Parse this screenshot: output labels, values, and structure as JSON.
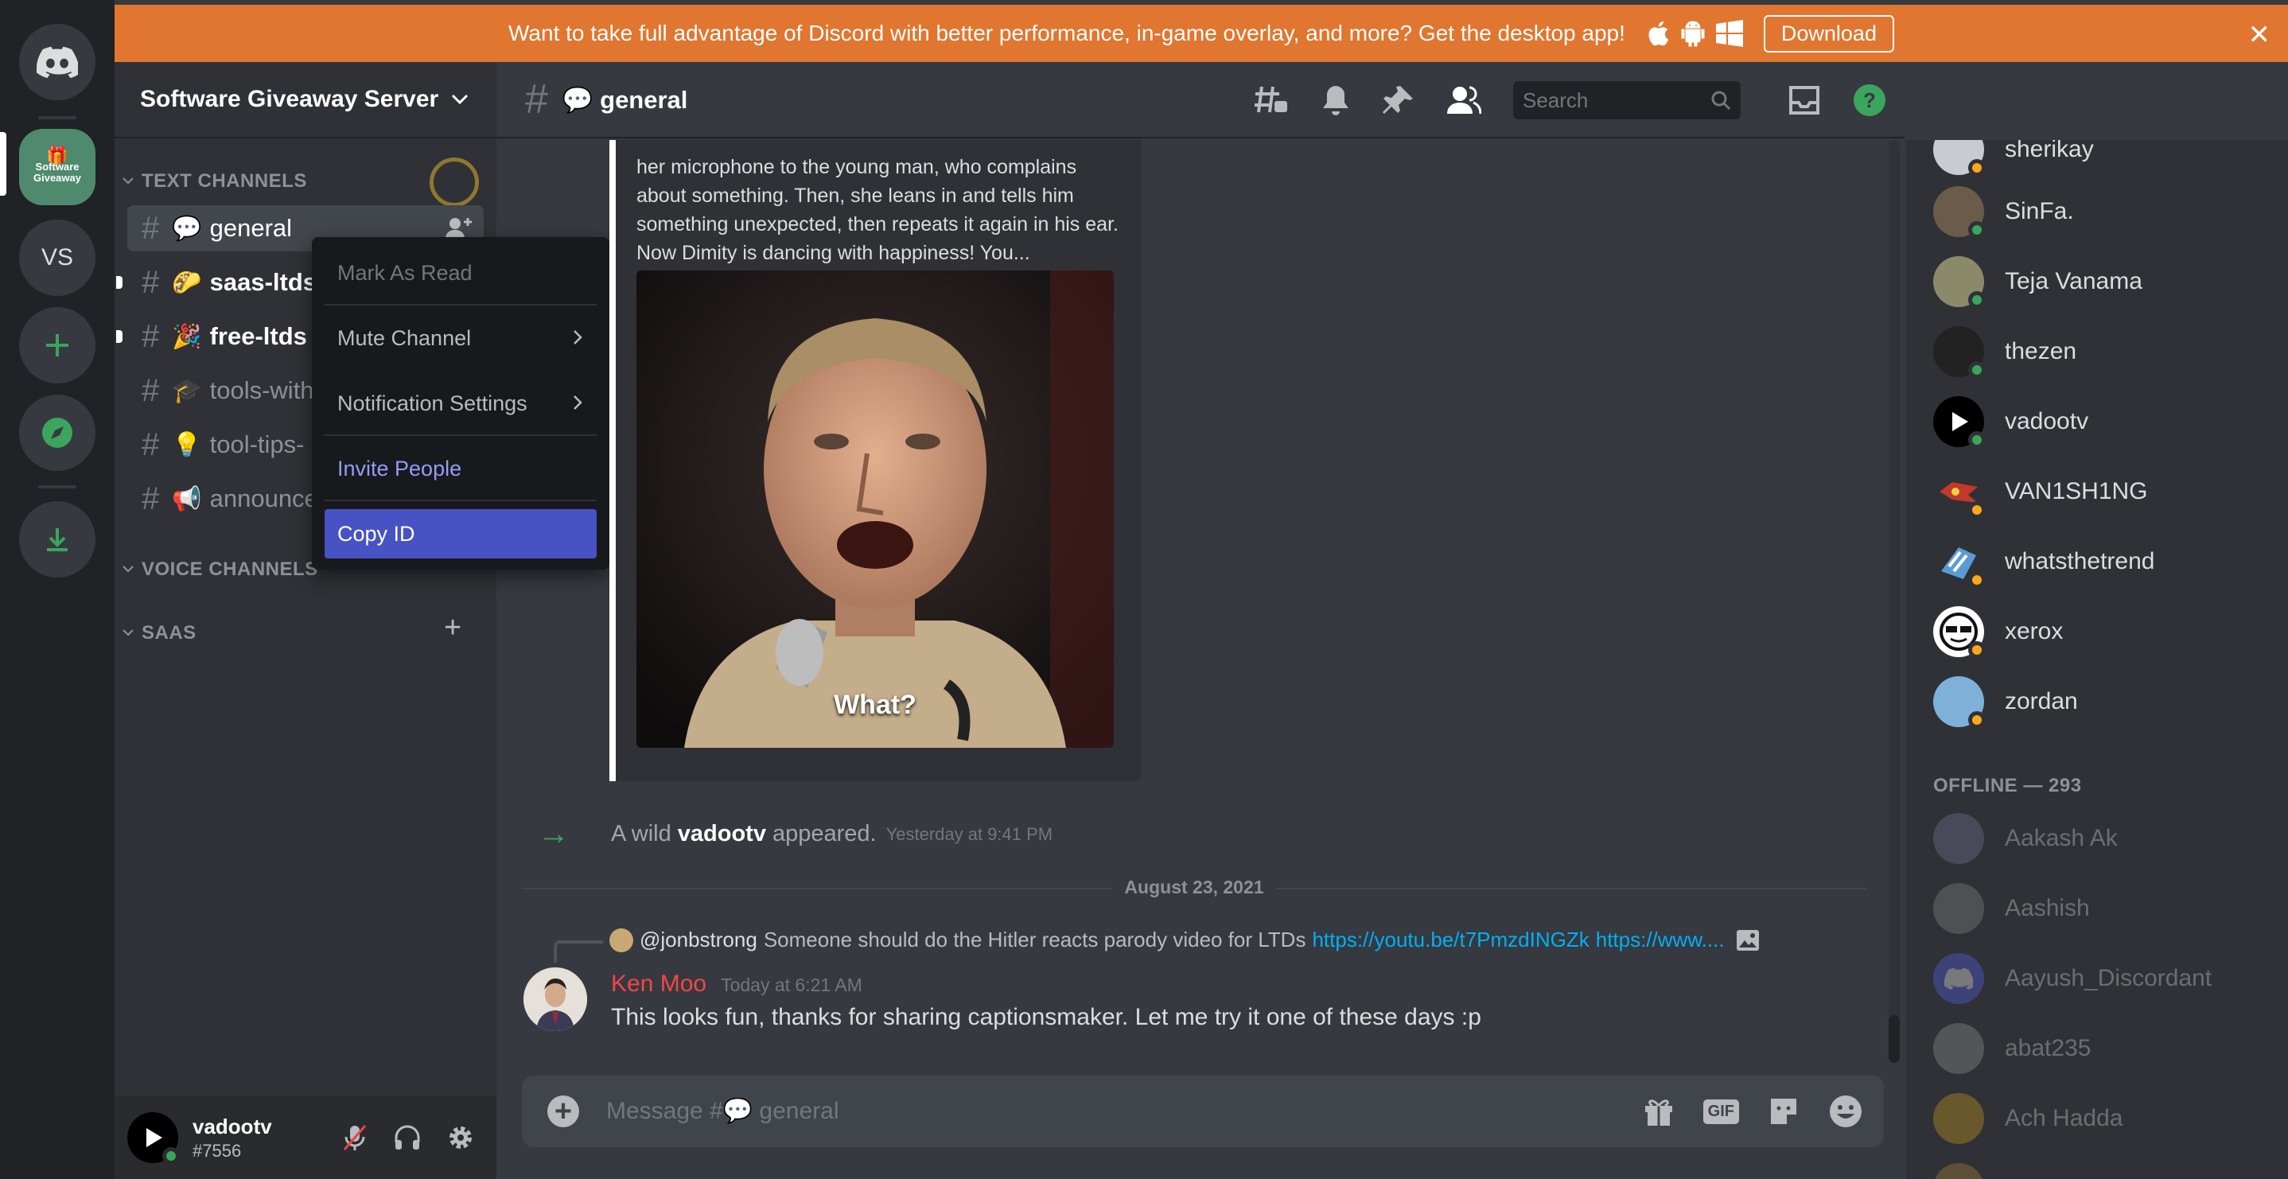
{
  "banner": {
    "text": "Want to take full advantage of Discord with better performance, in-game overlay, and more? Get the desktop app!",
    "download_label": "Download",
    "close_glyph": "✕"
  },
  "rail": {
    "home_icon": "discord-logo-icon",
    "active_server_label": "Software Giveaway",
    "server2_label": "VS",
    "add_icon": "plus-icon",
    "explore_icon": "compass-icon",
    "download_icon": "download-icon"
  },
  "server": {
    "name": "Software Giveaway Server"
  },
  "categories": {
    "text": "TEXT CHANNELS",
    "voice": "VOICE CHANNELS",
    "saas": "SAAS"
  },
  "channels": [
    {
      "emoji": "💬",
      "name": "general"
    },
    {
      "emoji": "🌮",
      "name": "saas-ltds"
    },
    {
      "emoji": "🎉",
      "name": "free-ltds"
    },
    {
      "emoji": "🎓",
      "name": "tools-with"
    },
    {
      "emoji": "💡",
      "name": "tool-tips-"
    },
    {
      "emoji": "📢",
      "name": "announce"
    }
  ],
  "context_menu": {
    "mark_read": "Mark As Read",
    "mute": "Mute Channel",
    "notifications": "Notification Settings",
    "invite": "Invite People",
    "copy_id": "Copy ID"
  },
  "user": {
    "name": "vadootv",
    "tag": "#7556"
  },
  "chat": {
    "channel_title": "💬 general",
    "search_placeholder": "Search",
    "embed_text": "her microphone to the young man, who complains about something. Then, she leans in and tells him something unexpected, then repeats it again in his ear. Now Dimity is dancing with happiness! You...",
    "embed_caption": "What?",
    "system_msg": {
      "prefix": "A wild",
      "user": "vadootv",
      "suffix": "appeared.",
      "time": "Yesterday at 9:41 PM"
    },
    "date_divider": "August 23, 2021",
    "reply": {
      "mention": "@jonbstrong",
      "text": "Someone should do the Hitler reacts parody video for LTDs",
      "link1": "https://youtu.be/t7PmzdINGZk",
      "link2": "https://www...."
    },
    "message": {
      "author": "Ken Moo",
      "timestamp": "Today at 6:21 AM",
      "body": "This looks fun, thanks for sharing captionsmaker. Let me try it one of these days :p"
    },
    "composer_placeholder": "Message #💬 general"
  },
  "members": {
    "online": [
      {
        "name": "sherikay",
        "status": "idle",
        "color": "#c8ccd2"
      },
      {
        "name": "SinFa.",
        "status": "online",
        "color": "#6b5b4b"
      },
      {
        "name": "Teja Vanama",
        "status": "online",
        "color": "#8a8a6a"
      },
      {
        "name": "thezen",
        "status": "online",
        "color": "#222222"
      },
      {
        "name": "vadootv",
        "status": "online",
        "color": "#000000"
      },
      {
        "name": "VAN1SH1NG",
        "status": "idle",
        "color": "#c0392b"
      },
      {
        "name": "whatsthetrend",
        "status": "idle",
        "color": "#5b9bd5"
      },
      {
        "name": "xerox",
        "status": "idle",
        "color": "#ffffff"
      },
      {
        "name": "zordan",
        "status": "idle",
        "color": "#7fb0d8"
      }
    ],
    "offline_title": "OFFLINE — 293",
    "offline": [
      {
        "name": "Aakash Ak",
        "color": "#7a7a9a"
      },
      {
        "name": "Aashish",
        "color": "#8a8a8a"
      },
      {
        "name": "Aayush_Discordant",
        "color": "#5865f2"
      },
      {
        "name": "abat235",
        "color": "#9a9a9a"
      },
      {
        "name": "Ach Hadda",
        "color": "#d4a017"
      }
    ]
  }
}
